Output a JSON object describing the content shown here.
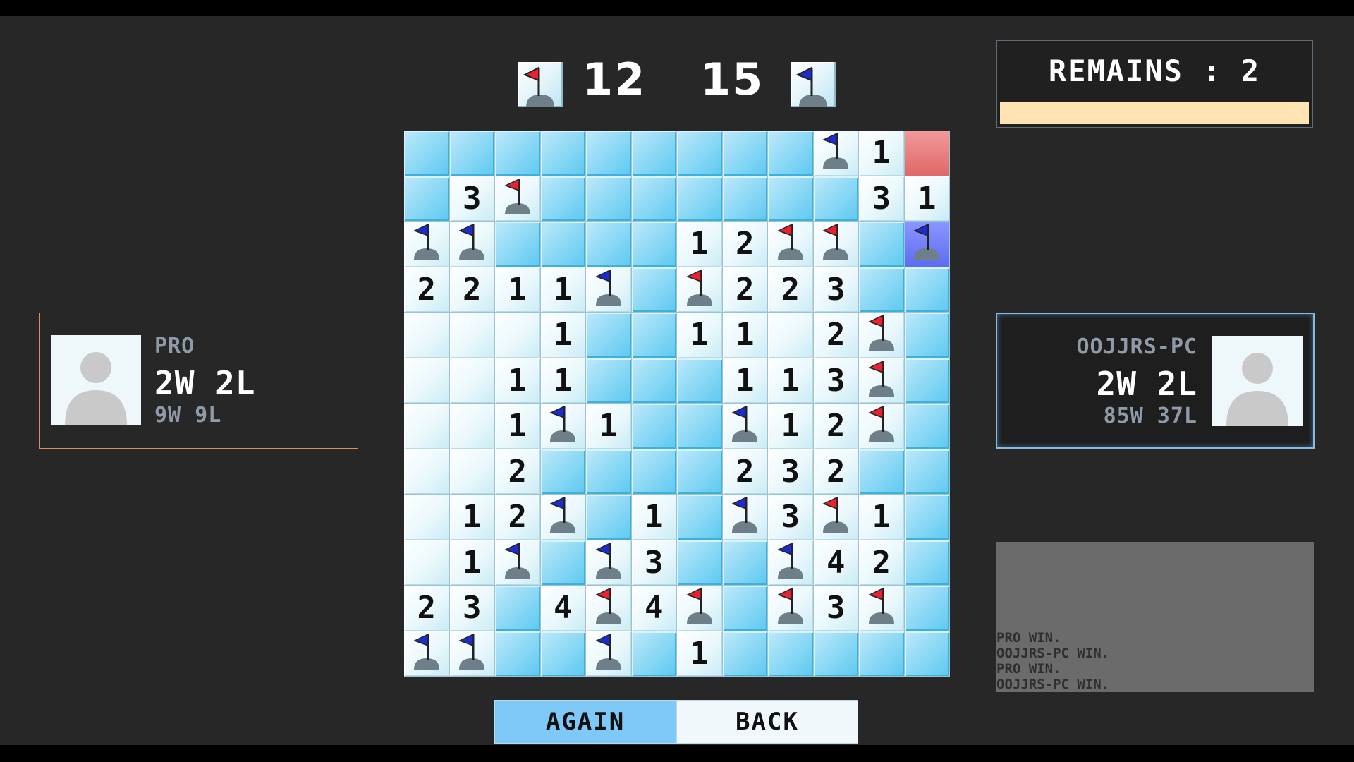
{
  "score": {
    "red": "12",
    "blue": "15"
  },
  "remains": {
    "label": "REMAINS : 2",
    "progress_fraction": 1.0
  },
  "players": {
    "left": {
      "name": "PRO",
      "record": "2W 2L",
      "total": "9W 9L"
    },
    "right": {
      "name": "OOJJRS-PC",
      "record": "2W 2L",
      "total": "85W 37L"
    }
  },
  "board": [
    [
      "H",
      "H",
      "H",
      "H",
      "H",
      "H",
      "H",
      "H",
      "H",
      "FB",
      "1",
      "XR"
    ],
    [
      "H",
      "3",
      "FR",
      "H",
      "H",
      "H",
      "H",
      "H",
      "H",
      "H",
      "3",
      "1"
    ],
    [
      "FB",
      "FB",
      "H",
      "H",
      "H",
      "H",
      "1",
      "2",
      "FR",
      "FR",
      "H",
      "XB"
    ],
    [
      "2",
      "2",
      "1",
      "1",
      "FB",
      "H",
      "FR",
      "2",
      "2",
      "3",
      "H",
      "H"
    ],
    [
      "O",
      "O",
      "O",
      "1",
      "H",
      "H",
      "1",
      "1",
      "O",
      "2",
      "FR",
      "H"
    ],
    [
      "O",
      "O",
      "1",
      "1",
      "H",
      "H",
      "H",
      "1",
      "1",
      "3",
      "FR",
      "H"
    ],
    [
      "O",
      "O",
      "1",
      "FB",
      "1",
      "H",
      "H",
      "FB",
      "1",
      "2",
      "FR",
      "H"
    ],
    [
      "O",
      "O",
      "2",
      "H",
      "H",
      "H",
      "H",
      "2",
      "3",
      "2",
      "H",
      "H"
    ],
    [
      "O",
      "1",
      "2",
      "FB",
      "H",
      "1",
      "H",
      "FB",
      "3",
      "FR",
      "1",
      "H"
    ],
    [
      "O",
      "1",
      "FB",
      "H",
      "FB",
      "3",
      "H",
      "H",
      "FB",
      "4",
      "2",
      "H"
    ],
    [
      "2",
      "3",
      "H",
      "4",
      "FR",
      "4",
      "FR",
      "H",
      "FR",
      "3",
      "FR",
      "H"
    ],
    [
      "FB",
      "FB",
      "H",
      "H",
      "FB",
      "H",
      "1",
      "H",
      "H",
      "H",
      "H",
      "H"
    ]
  ],
  "log": [
    "PRO WIN.",
    "OOJJRS-PC WIN.",
    "PRO WIN.",
    "OOJJRS-PC WIN."
  ],
  "buttons": {
    "again": "AGAIN",
    "back": "BACK"
  },
  "colors": {
    "red_flag": "#e8222e",
    "blue_flag": "#1c2ccf",
    "remains_bar": "#ffe3b3",
    "again_button": "#7ec9f7"
  }
}
